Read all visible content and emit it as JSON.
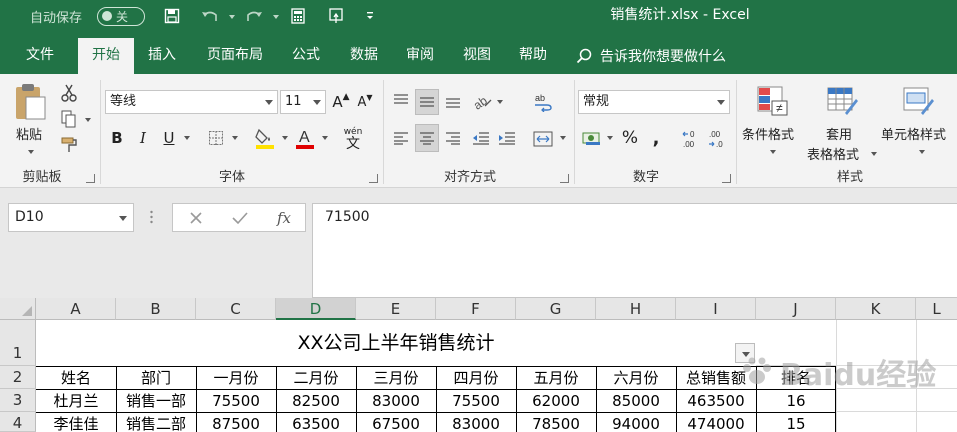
{
  "titlebar": {
    "autosave_label": "自动保存",
    "autosave_state": "关",
    "doc_title": "销售统计.xlsx  -  Excel"
  },
  "tabs": [
    "文件",
    "开始",
    "插入",
    "页面布局",
    "公式",
    "数据",
    "审阅",
    "视图",
    "帮助"
  ],
  "active_tab": "开始",
  "tellme": "告诉我你想要做什么",
  "ribbon": {
    "clipboard": {
      "paste_label": "粘贴",
      "group_label": "剪贴板"
    },
    "font": {
      "font_name": "等线",
      "font_size": "11",
      "group_label": "字体",
      "bold": "B",
      "italic": "I",
      "underline": "U",
      "phonetic": "wén",
      "font_color": "#e00000",
      "fill_color": "#ffe100"
    },
    "alignment": {
      "group_label": "对齐方式"
    },
    "number": {
      "format": "常规",
      "group_label": "数字",
      "percent": "%",
      "comma": ","
    },
    "styles": {
      "conditional": "条件格式",
      "table_1": "套用",
      "table_2": "表格格式",
      "cell_styles": "单元格样式",
      "group_label": "样式"
    }
  },
  "formula_bar": {
    "name_box": "D10",
    "fx": "fx",
    "value": "71500"
  },
  "sheet": {
    "columns": [
      "A",
      "B",
      "C",
      "D",
      "E",
      "F",
      "G",
      "H",
      "I",
      "J",
      "K",
      "L"
    ],
    "selected_column": "D",
    "rows": [
      "1",
      "2",
      "3",
      "4"
    ],
    "title": "XX公司上半年销售统计",
    "headers": [
      "姓名",
      "部门",
      "一月份",
      "二月份",
      "三月份",
      "四月份",
      "五月份",
      "六月份",
      "总销售额",
      "排名"
    ],
    "data": [
      [
        "杜月兰",
        "销售一部",
        "75500",
        "82500",
        "83000",
        "75500",
        "62000",
        "85000",
        "463500",
        "16"
      ],
      [
        "李佳佳",
        "销售二部",
        "87500",
        "63500",
        "67500",
        "83000",
        "78500",
        "94000",
        "474000",
        "15"
      ]
    ]
  },
  "watermark": "Baidu经验"
}
